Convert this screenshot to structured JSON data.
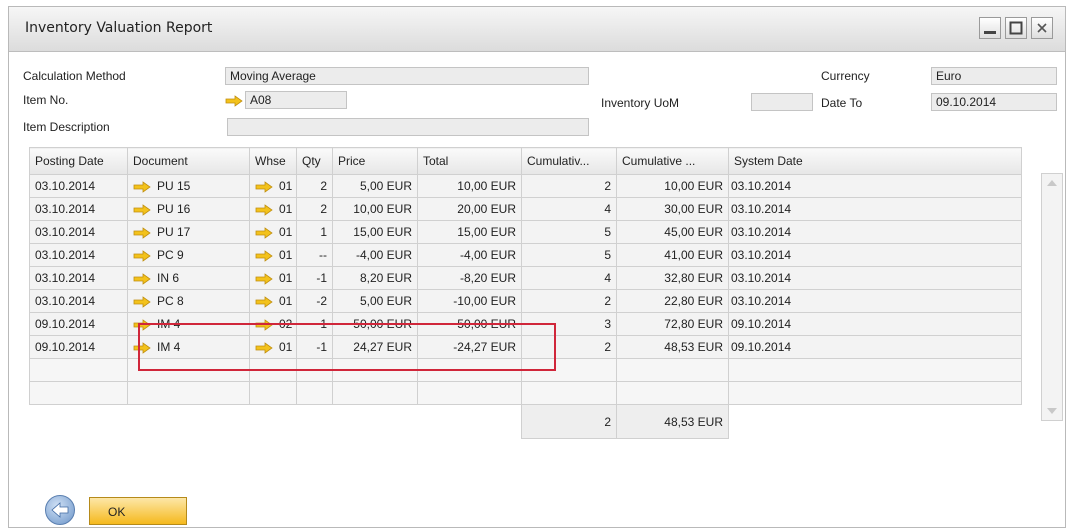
{
  "window": {
    "title": "Inventory Valuation Report"
  },
  "header": {
    "calculation_method_label": "Calculation Method",
    "calculation_method_value": "Moving Average",
    "item_no_label": "Item No.",
    "item_no_value": "A08",
    "item_description_label": "Item Description",
    "item_description_value": "",
    "inventory_uom_label": "Inventory UoM",
    "inventory_uom_value": "",
    "currency_label": "Currency",
    "currency_value": "Euro",
    "date_to_label": "Date To",
    "date_to_value": "09.10.2014"
  },
  "grid": {
    "columns": [
      "Posting Date",
      "Document",
      "Whse",
      "Qty",
      "Price",
      "Total",
      "Cumulativ...",
      "Cumulative ...",
      "System Date"
    ],
    "rows": [
      {
        "posting_date": "03.10.2014",
        "document": "PU 15",
        "whse": "01",
        "qty": "2",
        "price": "5,00 EUR",
        "total": "10,00 EUR",
        "cum_qty": "2",
        "cum_value": "10,00 EUR",
        "system_date": "03.10.2014"
      },
      {
        "posting_date": "03.10.2014",
        "document": "PU 16",
        "whse": "01",
        "qty": "2",
        "price": "10,00 EUR",
        "total": "20,00 EUR",
        "cum_qty": "4",
        "cum_value": "30,00 EUR",
        "system_date": "03.10.2014"
      },
      {
        "posting_date": "03.10.2014",
        "document": "PU 17",
        "whse": "01",
        "qty": "1",
        "price": "15,00 EUR",
        "total": "15,00 EUR",
        "cum_qty": "5",
        "cum_value": "45,00 EUR",
        "system_date": "03.10.2014"
      },
      {
        "posting_date": "03.10.2014",
        "document": "PC 9",
        "whse": "01",
        "qty": "--",
        "price": "-4,00 EUR",
        "total": "-4,00 EUR",
        "cum_qty": "5",
        "cum_value": "41,00 EUR",
        "system_date": "03.10.2014"
      },
      {
        "posting_date": "03.10.2014",
        "document": "IN 6",
        "whse": "01",
        "qty": "-1",
        "price": "8,20 EUR",
        "total": "-8,20 EUR",
        "cum_qty": "4",
        "cum_value": "32,80 EUR",
        "system_date": "03.10.2014"
      },
      {
        "posting_date": "03.10.2014",
        "document": "PC 8",
        "whse": "01",
        "qty": "-2",
        "price": "5,00 EUR",
        "total": "-10,00 EUR",
        "cum_qty": "2",
        "cum_value": "22,80 EUR",
        "system_date": "03.10.2014"
      },
      {
        "posting_date": "09.10.2014",
        "document": "IM 4",
        "whse": "02",
        "qty": "1",
        "price": "50,00 EUR",
        "total": "50,00 EUR",
        "cum_qty": "3",
        "cum_value": "72,80 EUR",
        "system_date": "09.10.2014"
      },
      {
        "posting_date": "09.10.2014",
        "document": "IM 4",
        "whse": "01",
        "qty": "-1",
        "price": "24,27 EUR",
        "total": "-24,27 EUR",
        "cum_qty": "2",
        "cum_value": "48,53 EUR",
        "system_date": "09.10.2014"
      }
    ],
    "footer": {
      "cum_qty": "2",
      "cum_value": "48,53 EUR"
    }
  },
  "buttons": {
    "ok_label": "OK"
  },
  "colors": {
    "highlight": "#d0263a",
    "link_arrow": "#f3c21b",
    "ok_button": "#f5b91e"
  },
  "icons": {
    "link_arrow": "golden-arrow-icon",
    "back": "back-arrow-icon",
    "minimize": "minimize-icon",
    "maximize": "maximize-icon",
    "close": "close-icon"
  }
}
